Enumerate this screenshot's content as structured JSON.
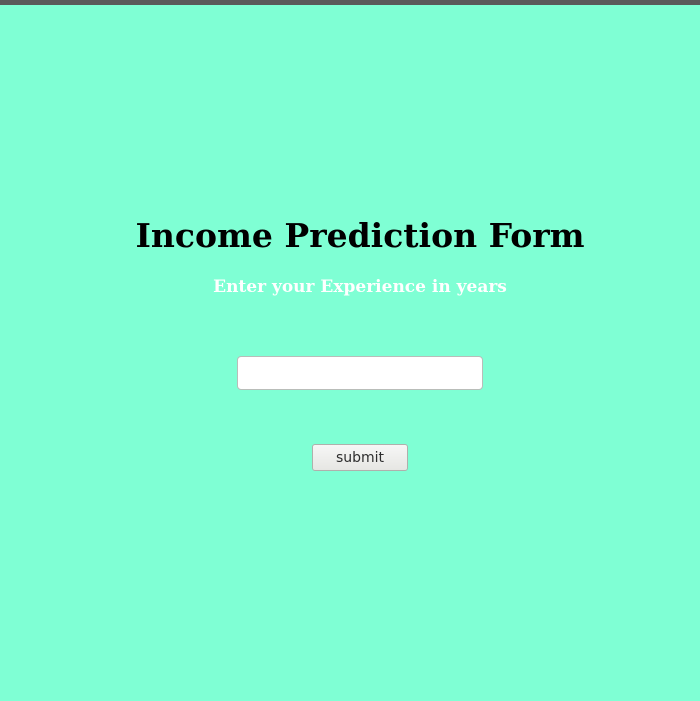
{
  "form": {
    "title": "Income Prediction Form",
    "prompt": "Enter your Experience in years",
    "experience_value": "",
    "experience_placeholder": "",
    "submit_label": "submit"
  },
  "colors": {
    "background": "#7fffd4",
    "title": "#000000",
    "prompt": "#ffffff",
    "top_bar": "#5a5a5a"
  }
}
